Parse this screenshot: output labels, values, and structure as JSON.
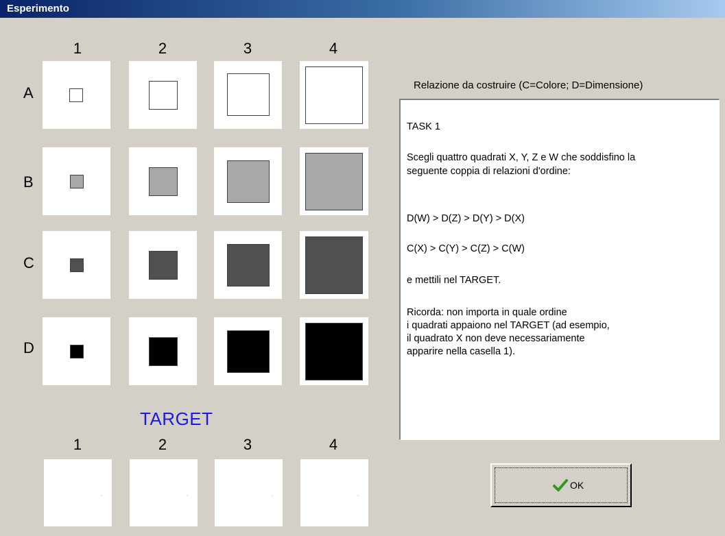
{
  "window": {
    "title": "Esperimento"
  },
  "grid": {
    "col_labels": [
      "1",
      "2",
      "3",
      "4"
    ],
    "row_labels": [
      "A",
      "B",
      "C",
      "D"
    ],
    "row_colors": [
      "#ffffff",
      "#a8a8a8",
      "#505050",
      "#000000"
    ]
  },
  "target": {
    "title": "TARGET",
    "col_labels": [
      "1",
      "2",
      "3",
      "4"
    ]
  },
  "relation": {
    "heading": "Relazione da costruire (C=Colore; D=Dimensione)",
    "lines": [
      "TASK 1",
      "Scegli quattro quadrati X, Y, Z e W che soddisfino la",
      "seguente coppia di relazioni d'ordine:",
      "D(W) > D(Z) > D(Y) > D(X)",
      "C(X) > C(Y) > C(Z) > C(W)",
      "e mettili nel TARGET.",
      "Ricorda: non importa in quale ordine",
      "i quadrati appaiono nel TARGET (ad esempio,",
      "il quadrato X non deve necessariamente",
      "apparire nella casella 1)."
    ]
  },
  "ok_button": {
    "label": "OK",
    "icon": "checkmark-icon"
  }
}
